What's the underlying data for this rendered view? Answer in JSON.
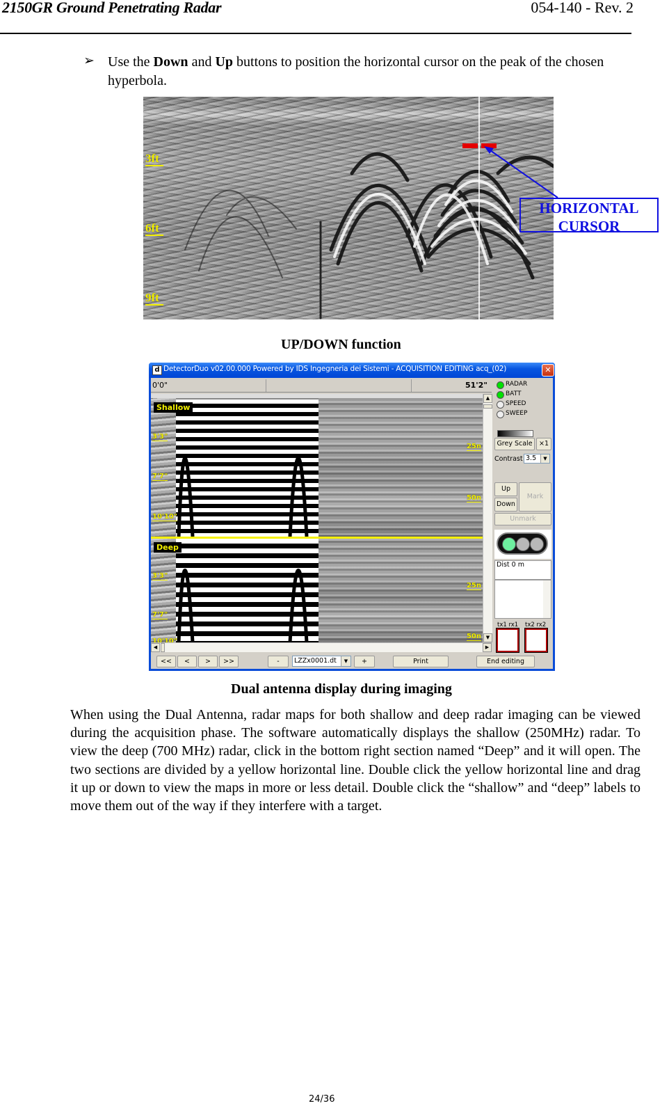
{
  "header": {
    "title": "2150GR Ground Penetrating Radar",
    "revision": "054-140 - Rev. 2"
  },
  "instruction": {
    "bullet_glyph": "➢",
    "parts": [
      "Use the ",
      "Down",
      " and ",
      "Up",
      " buttons to position the horizontal cursor on the peak of the chosen hyperbola."
    ]
  },
  "figure1": {
    "depth_labels": [
      "3ft",
      "6ft",
      "9ft"
    ],
    "callout": {
      "line1": "HORIZONTAL",
      "line2": "CURSOR"
    },
    "caption": "UP/DOWN function",
    "colors": {
      "cursor": "#e40000",
      "callout": "#1010e0",
      "depth_label": "#f3f000"
    }
  },
  "figure2": {
    "window": {
      "icon": "d",
      "title": "DetectorDuo v02.00.000 Powered by IDS Ingegneria dei Sistemi - ACQUISITION EDITING  acq_(02)",
      "close_glyph": "✕"
    },
    "ruler": {
      "start": "0'0\"",
      "end": "51'2\""
    },
    "sections": [
      {
        "label": "Shallow",
        "depth_labels": [
          "3'3\"",
          "7'7\"",
          "10'10\""
        ],
        "time_labels": [
          "25n",
          "50n"
        ]
      },
      {
        "label": "Deep",
        "depth_labels": [
          "3'3\"",
          "7'7\"",
          "10'10\""
        ],
        "time_labels": [
          "25n",
          "50n"
        ]
      }
    ],
    "status": [
      {
        "label": "RADAR",
        "state": "on"
      },
      {
        "label": "BATT",
        "state": "on"
      },
      {
        "label": "SPEED",
        "state": "off"
      },
      {
        "label": "SWEEP",
        "state": "off"
      }
    ],
    "grey_scale_button": "Grey Scale",
    "zoom_button": "×1",
    "contrast_label": "Contrast",
    "contrast_value": "3.5",
    "up_button": "Up",
    "down_button": "Down",
    "mark_button": "Mark",
    "unmark_button": "Unmark",
    "dist_text": "Dist 0 m",
    "antennas": [
      "tx1 rx1",
      "tx2 rx2"
    ],
    "toolbar": {
      "first": "<<",
      "prev": "<",
      "next": ">",
      "last": ">>",
      "minus": "-",
      "file": "LZZx0001.dt",
      "plus": "+",
      "print": "Print",
      "end_editing": "End editing"
    },
    "caption": "Dual antenna display during imaging",
    "colors": {
      "divider": "#f5f000",
      "led_on": "#00e000",
      "title_bar": "#0046d6"
    }
  },
  "body_text": "When using the Dual Antenna, radar maps for both shallow and deep radar imaging can be viewed during the acquisition phase. The software automatically displays the shallow (250MHz) radar. To view the deep (700 MHz) radar, click in the bottom right section named “Deep” and it will open. The two sections are divided by a yellow horizontal line. Double click the yellow horizontal line and drag it up or down to view the maps in more or less detail.  Double click the “shallow” and “deep” labels to move them out of the way if they interfere with a target.",
  "footer": {
    "page": "24/36"
  }
}
